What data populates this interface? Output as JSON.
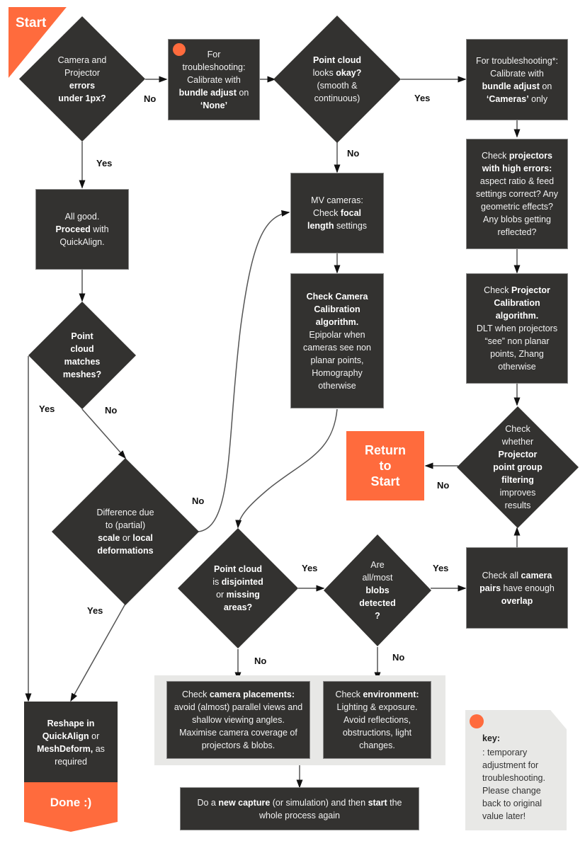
{
  "colors": {
    "accent": "#ff6b3d",
    "node": "#333230",
    "panel": "#e8e8e6",
    "text_light": "#f2f2f2",
    "label": "#111111"
  },
  "start": {
    "label": "Start"
  },
  "nodes": {
    "errors": [
      "Camera and",
      "Projector",
      "**errors**",
      "**under 1px?**"
    ],
    "bundle_none": [
      "For",
      "troubleshooting:",
      "Calibrate with",
      "**bundle adjust** on",
      "**‘None’**"
    ],
    "point_ok": [
      "**Point cloud**",
      "looks **okay?**",
      "(smooth &",
      "continuous)"
    ],
    "bundle_cameras": [
      "For troubleshooting*:",
      "Calibrate with",
      "**bundle adjust** on",
      "**‘Cameras’** only"
    ],
    "all_good": [
      "All good.",
      "**Proceed** with",
      "QuickAlign."
    ],
    "mv_cameras": [
      "MV cameras:",
      "Check **focal**",
      "**length** settings"
    ],
    "projectors_errors": [
      "Check **projectors**",
      "**with high errors:**",
      "aspect ratio & feed",
      "settings correct? Any",
      "geometric effects?",
      "Any blobs getting",
      "reflected?"
    ],
    "matches_meshes": [
      "**Point**",
      "**cloud**",
      "**matches**",
      "**meshes?**"
    ],
    "camera_calib": [
      "**Check Camera**",
      "**Calibration**",
      "**algorithm.**",
      "Epipolar when",
      "cameras see non",
      "planar points,",
      "Homography",
      "otherwise"
    ],
    "projector_calib": [
      "Check **Projector**",
      "**Calibration**",
      "**algorithm.**",
      "DLT when projectors",
      "“see” non planar",
      "points, Zhang",
      "otherwise"
    ],
    "return_start": [
      "Return",
      "to",
      "Start"
    ],
    "filtering": [
      "Check",
      "whether",
      "**Projector**",
      "**point group**",
      "**filtering**",
      "improves",
      "results"
    ],
    "difference": [
      "Difference due",
      "to (partial)",
      "**scale** or **local**",
      "**deformations**"
    ],
    "disjointed": [
      "**Point cloud**",
      "is **disjointed**",
      "or  **missing**",
      "**areas?**"
    ],
    "blobs": [
      "Are",
      "all/most",
      "**blobs**",
      "**detected**",
      "**?**"
    ],
    "overlap": [
      "Check all **camera**",
      "**pairs** have enough",
      "**overlap**"
    ],
    "placements": [
      "Check **camera placements:**",
      "avoid (almost) parallel views and",
      "shallow viewing angles.",
      "Maximise camera coverage of",
      "projectors & blobs."
    ],
    "environment": [
      "Check **environment:**",
      "Lighting & exposure.",
      "Avoid reflections,",
      "obstructions, light",
      "changes."
    ],
    "reshape": [
      "**Reshape in**",
      "**QuickAlign** or",
      "**MeshDeform,** as",
      "required"
    ],
    "done": [
      "Done :)"
    ],
    "new_capture": [
      "Do a **new capture** (or simulation) and then **start** the",
      "whole process again"
    ]
  },
  "edge_labels": {
    "l1": "No",
    "l2": "Yes",
    "l3": "Yes",
    "l4": "No",
    "l5": "Yes",
    "l6": "No",
    "l7": "No",
    "l8": "Yes",
    "l9": "No",
    "l10": "Yes",
    "l11": "Yes",
    "l12": "No",
    "l13": "No"
  },
  "key": {
    "title": "key:",
    "text": [
      ": temporary",
      "adjustment for",
      "troubleshooting.",
      "Please change",
      "back to original",
      "value later!"
    ]
  }
}
